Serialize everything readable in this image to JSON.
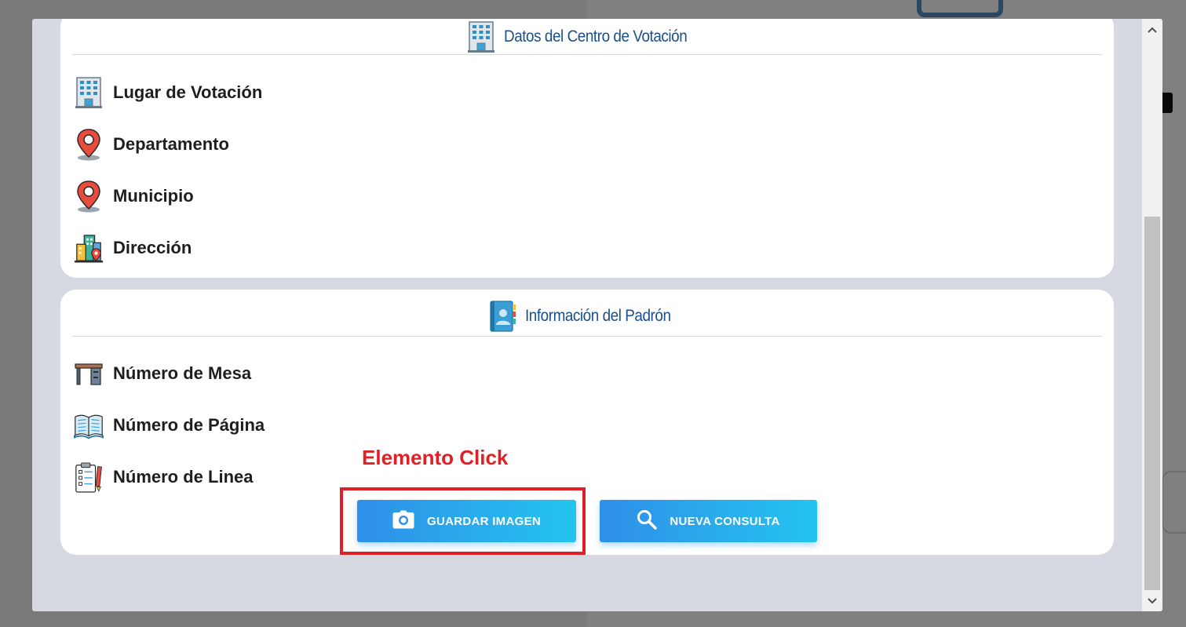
{
  "modal": {
    "card_centro": {
      "title": "Datos del Centro de Votación",
      "title_icon": "building-icon",
      "rows": [
        {
          "label": "Lugar de Votación",
          "icon": "building-icon"
        },
        {
          "label": "Departamento",
          "icon": "map-pin-icon"
        },
        {
          "label": "Municipio",
          "icon": "map-pin-icon"
        },
        {
          "label": "Dirección",
          "icon": "city-location-icon"
        }
      ]
    },
    "card_padron": {
      "title": "Información del Padrón",
      "title_icon": "address-book-icon",
      "rows": [
        {
          "label": "Número de Mesa",
          "icon": "desk-icon"
        },
        {
          "label": "Número de Página",
          "icon": "open-book-icon"
        },
        {
          "label": "Número de Linea",
          "icon": "checklist-icon"
        }
      ]
    },
    "buttons": {
      "save_label": "GUARDAR IMAGEN",
      "save_icon": "camera-icon",
      "new_label": "NUEVA CONSULTA",
      "new_icon": "search-icon"
    }
  },
  "annotation": {
    "label": "Elemento Click",
    "color": "#e01f26"
  },
  "colors": {
    "header_text": "#1d4f88",
    "button_gradient_start": "#2f8fe8",
    "button_gradient_end": "#24c4ef",
    "modal_background": "#d6d9e1"
  }
}
